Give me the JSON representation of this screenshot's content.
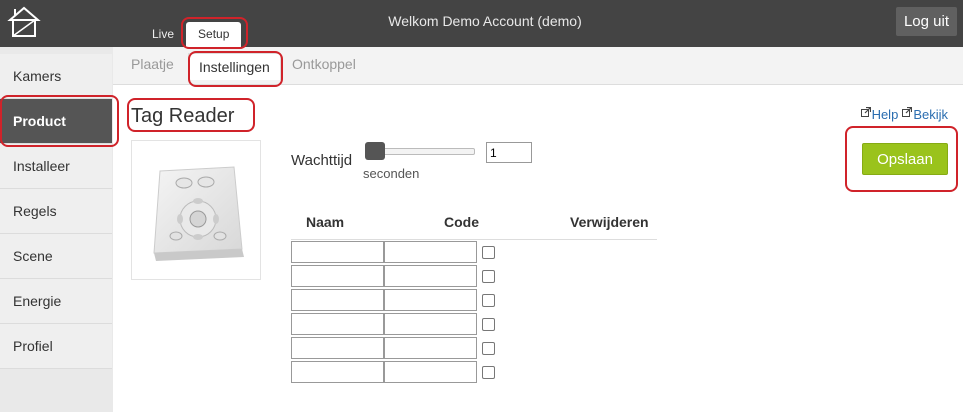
{
  "header": {
    "title": "Welkom Demo Account (demo)",
    "logout_label": "Log uit",
    "tabs": [
      {
        "label": "Live",
        "active": false
      },
      {
        "label": "Setup",
        "active": true
      }
    ]
  },
  "sidebar": {
    "items": [
      {
        "label": "Kamers",
        "active": false
      },
      {
        "label": "Product",
        "active": true
      },
      {
        "label": "Installeer",
        "active": false
      },
      {
        "label": "Regels",
        "active": false
      },
      {
        "label": "Scene",
        "active": false
      },
      {
        "label": "Energie",
        "active": false
      },
      {
        "label": "Profiel",
        "active": false
      }
    ]
  },
  "subtabs": [
    {
      "label": "Plaatje",
      "active": false
    },
    {
      "label": "Instellingen",
      "active": true
    },
    {
      "label": "Ontkoppel",
      "active": false
    }
  ],
  "product": {
    "title": "Tag Reader",
    "help_label": "Help",
    "view_label": "Bekijk",
    "save_label": "Opslaan",
    "wachttijd_label": "Wachttijd",
    "wachttijd_unit": "seconden",
    "wachttijd_value": "1"
  },
  "table": {
    "headers": [
      "Naam",
      "Code",
      "Verwijderen"
    ],
    "rows": [
      {
        "naam": "",
        "code": "",
        "remove": false
      },
      {
        "naam": "",
        "code": "",
        "remove": false
      },
      {
        "naam": "",
        "code": "",
        "remove": false
      },
      {
        "naam": "",
        "code": "",
        "remove": false
      },
      {
        "naam": "",
        "code": "",
        "remove": false
      },
      {
        "naam": "",
        "code": "",
        "remove": false
      }
    ]
  },
  "colors": {
    "topbar": "#444444",
    "sidebar_active": "#555555",
    "save_button": "#9ac31c",
    "highlight": "#d0232a",
    "link": "#2a6db0"
  }
}
